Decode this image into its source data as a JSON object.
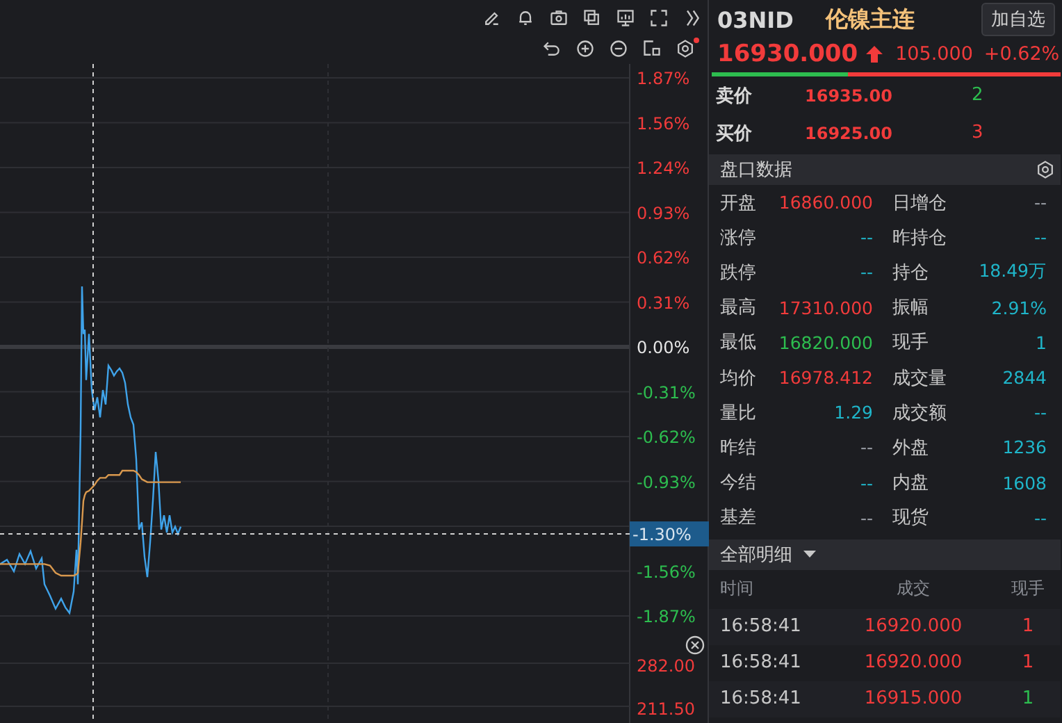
{
  "chart": {
    "y_axis_labels": [
      {
        "text": "1.87%",
        "color": "#f23b3b"
      },
      {
        "text": "1.56%",
        "color": "#f23b3b"
      },
      {
        "text": "1.24%",
        "color": "#f23b3b"
      },
      {
        "text": "0.93%",
        "color": "#f23b3b"
      },
      {
        "text": "0.62%",
        "color": "#f23b3b"
      },
      {
        "text": "0.31%",
        "color": "#f23b3b"
      },
      {
        "text": "0.00%",
        "color": "#e6e6e6"
      },
      {
        "text": "-0.31%",
        "color": "#2dbd4f"
      },
      {
        "text": "-0.62%",
        "color": "#2dbd4f"
      },
      {
        "text": "-0.93%",
        "color": "#2dbd4f"
      }
    ],
    "y_axis_bottom_labels": [
      {
        "text": "-1.56%",
        "color": "#2dbd4f"
      },
      {
        "text": "-1.87%",
        "color": "#2dbd4f"
      }
    ],
    "crosshair_label": "-1.30%",
    "volume_axis": [
      "282.00",
      "211.50"
    ]
  },
  "quote": {
    "code": "03NID",
    "name": "伦镍主连",
    "watch_button": "加自选",
    "price": "16930.000",
    "rising": true,
    "change": "105.000",
    "change_pct": "+0.62%",
    "buy_sell_ratio": {
      "level": 0.39
    }
  },
  "order_book": [
    {
      "label": "卖价",
      "price": "16935.00",
      "volume": "2",
      "color": "#2dbd4f"
    },
    {
      "label": "买价",
      "price": "16925.00",
      "volume": "3",
      "color": "#f23b3b"
    }
  ],
  "stats": {
    "title": "盘口数据",
    "items": [
      {
        "label": "开盘",
        "value": "16860.000",
        "color": "#f23b3b"
      },
      {
        "label": "日增仓",
        "value": "--",
        "color": "#9a9ea6"
      },
      {
        "label": "涨停",
        "value": "--",
        "color": "#1fb5c9"
      },
      {
        "label": "昨持仓",
        "value": "--",
        "color": "#1fb5c9"
      },
      {
        "label": "跌停",
        "value": "--",
        "color": "#1fb5c9"
      },
      {
        "label": "持仓",
        "value": "18.49万",
        "color": "#1fb5c9"
      },
      {
        "label": "最高",
        "value": "17310.000",
        "color": "#f23b3b"
      },
      {
        "label": "振幅",
        "value": "2.91%",
        "color": "#1fb5c9"
      },
      {
        "label": "最低",
        "value": "16820.000",
        "color": "#2dbd4f"
      },
      {
        "label": "现手",
        "value": "1",
        "color": "#1fb5c9"
      },
      {
        "label": "均价",
        "value": "16978.412",
        "color": "#f23b3b"
      },
      {
        "label": "成交量",
        "value": "2844",
        "color": "#1fb5c9"
      },
      {
        "label": "量比",
        "value": "1.29",
        "color": "#1fb5c9"
      },
      {
        "label": "成交额",
        "value": "--",
        "color": "#1fb5c9"
      },
      {
        "label": "昨结",
        "value": "--",
        "color": "#9a9ea6"
      },
      {
        "label": "外盘",
        "value": "1236",
        "color": "#1fb5c9"
      },
      {
        "label": "今结",
        "value": "--",
        "color": "#1fb5c9"
      },
      {
        "label": "内盘",
        "value": "1608",
        "color": "#1fb5c9"
      },
      {
        "label": "基差",
        "value": "--",
        "color": "#9a9ea6"
      },
      {
        "label": "现货",
        "value": "--",
        "color": "#1fb5c9"
      }
    ]
  },
  "trades": {
    "title": "全部明细",
    "columns": [
      "时间",
      "成交",
      "现手"
    ],
    "rows": [
      {
        "time": "16:58:41",
        "price": "16920.000",
        "volume": "1",
        "color": "#f23b3b"
      },
      {
        "time": "16:58:41",
        "price": "16920.000",
        "volume": "1",
        "color": "#f23b3b"
      },
      {
        "time": "16:58:41",
        "price": "16915.000",
        "volume": "1",
        "color": "#2dbd4f"
      }
    ]
  }
}
